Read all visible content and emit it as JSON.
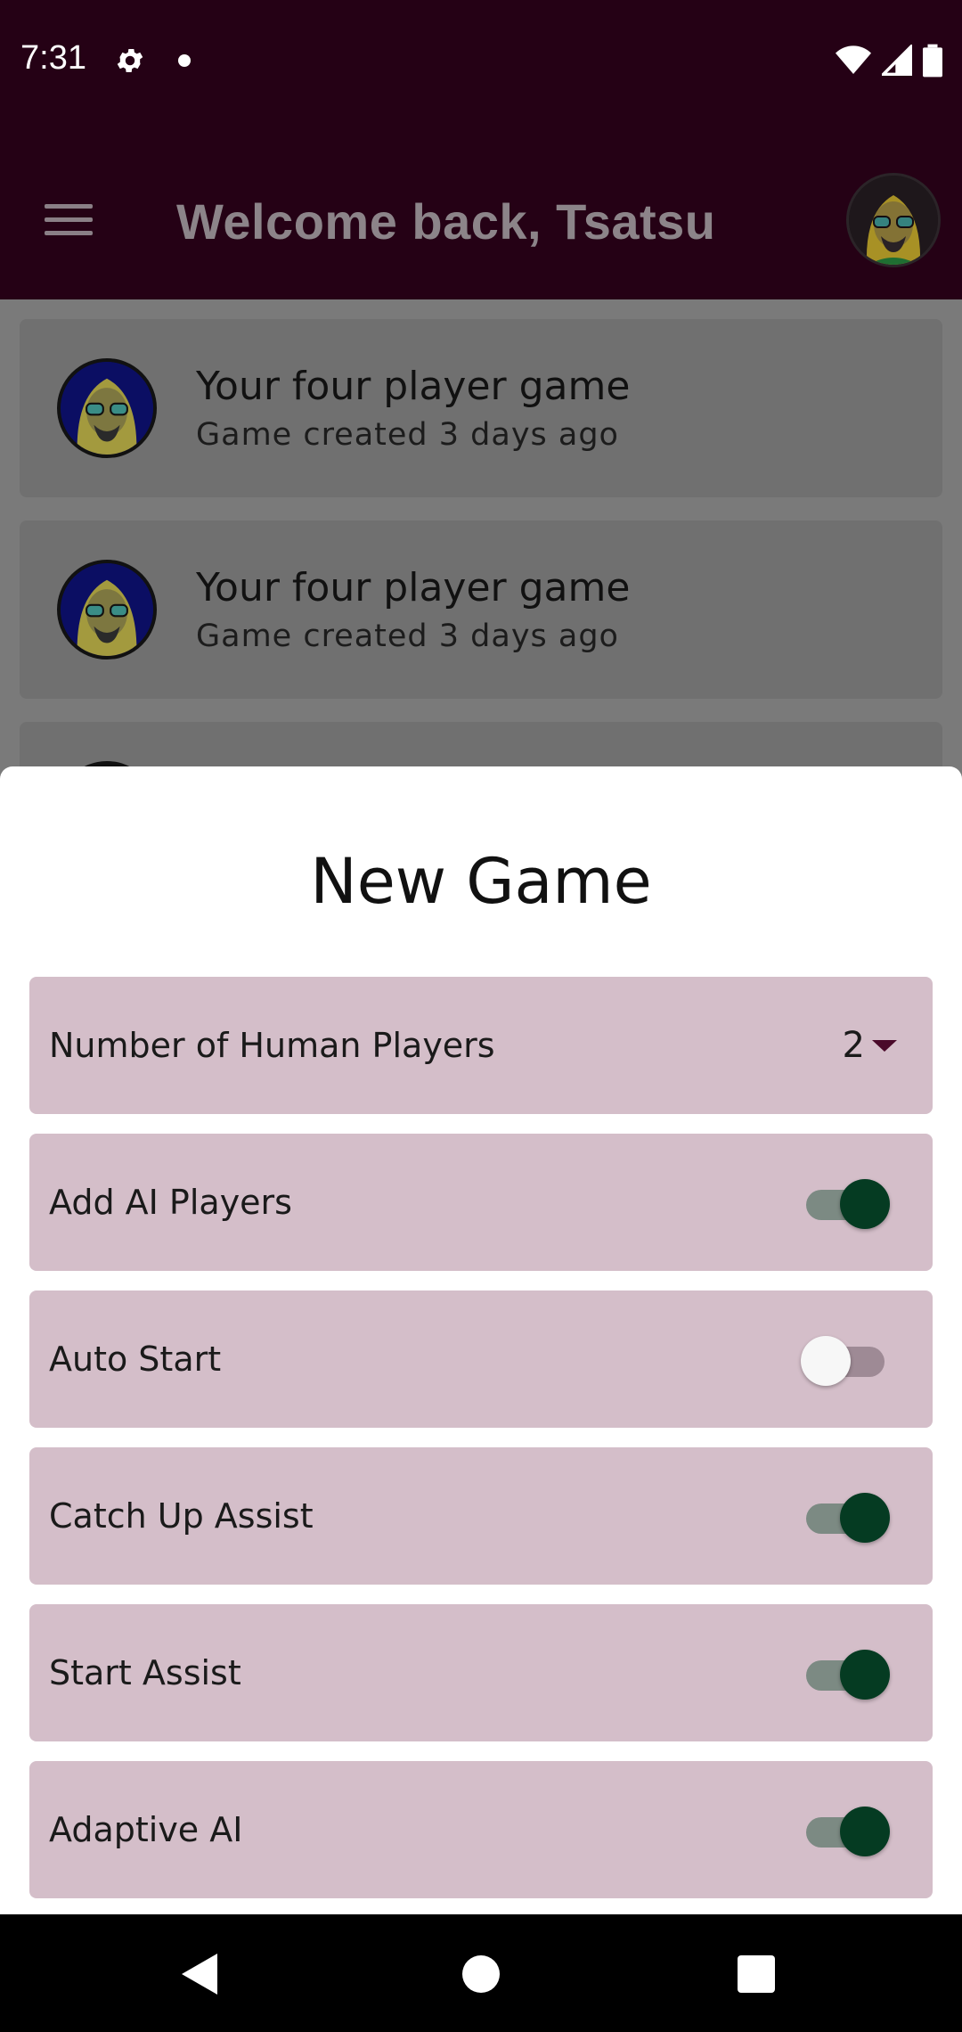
{
  "status_bar": {
    "time": "7:31",
    "icons": [
      "settings-icon",
      "notification-dot",
      "wifi-icon",
      "signal-icon",
      "battery-icon"
    ]
  },
  "app_bar": {
    "title": "Welcome back, Tsatsu",
    "icons": [
      "menu-icon",
      "profile-avatar"
    ]
  },
  "games": [
    {
      "title": "Your four player game",
      "subtitle": "Game created 3 days ago"
    },
    {
      "title": "Your four player game",
      "subtitle": "Game created 3 days ago"
    }
  ],
  "new_game_sheet": {
    "title": "New Game",
    "human_players": {
      "label": "Number of Human Players",
      "value": "2"
    },
    "options": [
      {
        "label": "Add AI Players",
        "on": true
      },
      {
        "label": "Auto Start",
        "on": false
      },
      {
        "label": "Catch Up Assist",
        "on": true
      },
      {
        "label": "Start Assist",
        "on": true
      },
      {
        "label": "Adaptive AI",
        "on": true
      }
    ]
  },
  "colors": {
    "app_bar": "#250115",
    "option_bg": "#d4bec9",
    "toggle_on": "#053b22",
    "scrim": "#7a7a7a"
  },
  "nav_bar": {
    "icons": [
      "back-icon",
      "home-icon",
      "recents-icon"
    ]
  }
}
